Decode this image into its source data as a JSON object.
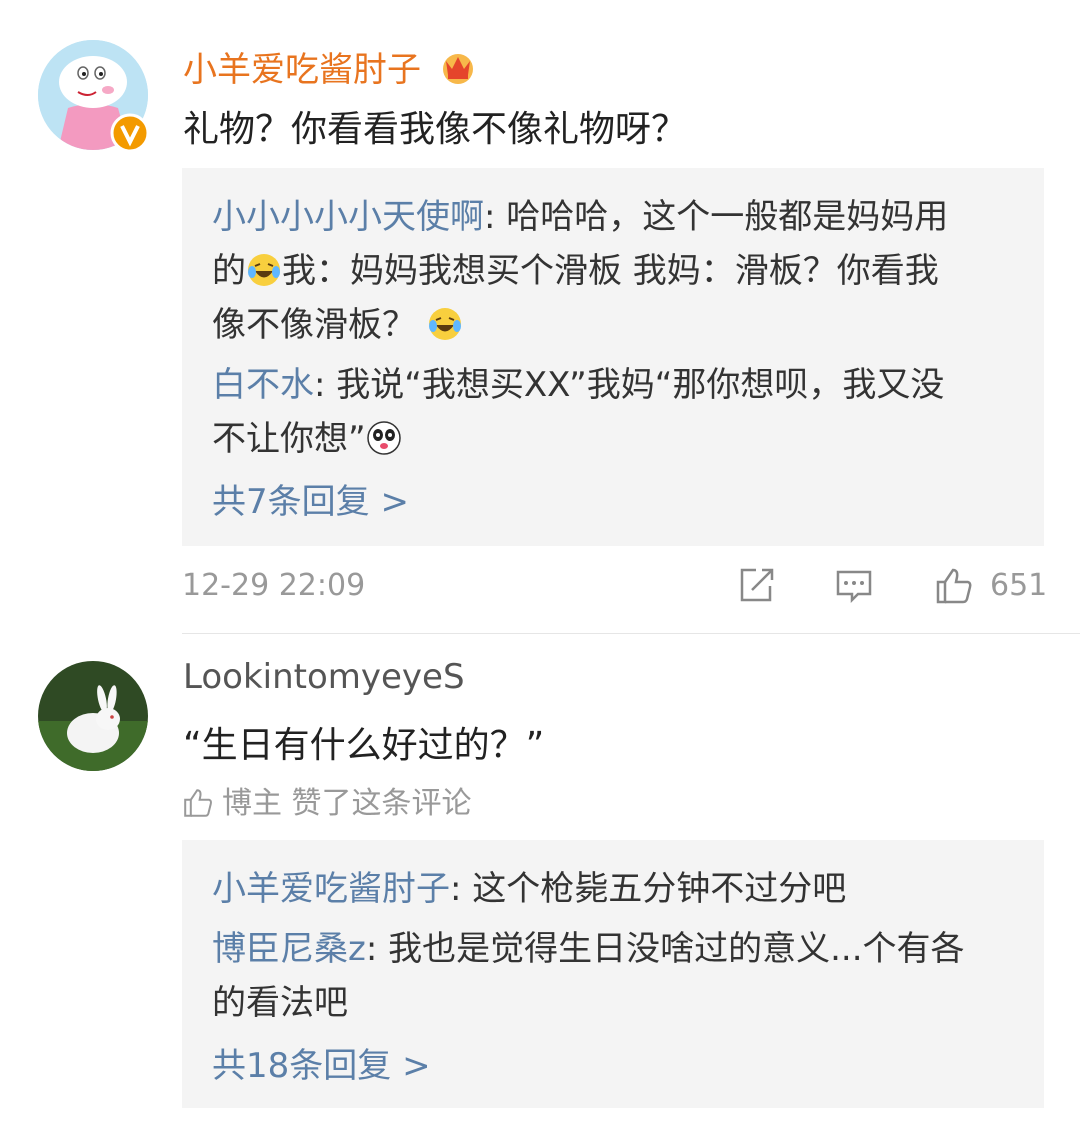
{
  "comments": [
    {
      "username": "小羊爱吃酱肘子",
      "content": "礼物？你看看我像不像礼物呀？",
      "replies": [
        {
          "name": "小小小小小天使啊",
          "sep": ": ",
          "text_lines": [
            "哈哈哈，这个一般都是妈妈用",
            "的",
            "我：妈妈我想买个滑板  我妈：滑板？你看我",
            "像不像滑板？ "
          ]
        },
        {
          "name": "白不水",
          "sep": ": ",
          "text_lines": [
            "我说“我想买XX”我妈“那你想呗，我又没",
            "不让你想”"
          ]
        }
      ],
      "more_replies": "共7条回复 >",
      "time": "12-29 22:09",
      "like_count": "651"
    },
    {
      "username": "LookintomyeyeS",
      "content": "“生日有什么好过的？”",
      "liked_by_author": "博主 赞了这条评论",
      "replies": [
        {
          "name": "小羊爱吃酱肘子",
          "sep": ": ",
          "text": "这个枪毙五分钟不过分吧"
        },
        {
          "name": "博臣尼桑z",
          "sep": ": ",
          "text_lines": [
            "我也是觉得生日没啥过的意义...个有各",
            "的看法吧"
          ]
        }
      ],
      "more_replies": "共18条回复 >"
    }
  ],
  "colors": {
    "username_orange": "#e8741f",
    "reply_name_blue": "#5b7fa8",
    "reply_bg": "#f4f4f4",
    "meta_gray": "#999999"
  },
  "icons": [
    "crown-badge-icon",
    "verified-v-icon",
    "laughing-crying-emoji",
    "panda-emoji",
    "share-icon",
    "comment-icon",
    "thumbs-up-icon"
  ]
}
